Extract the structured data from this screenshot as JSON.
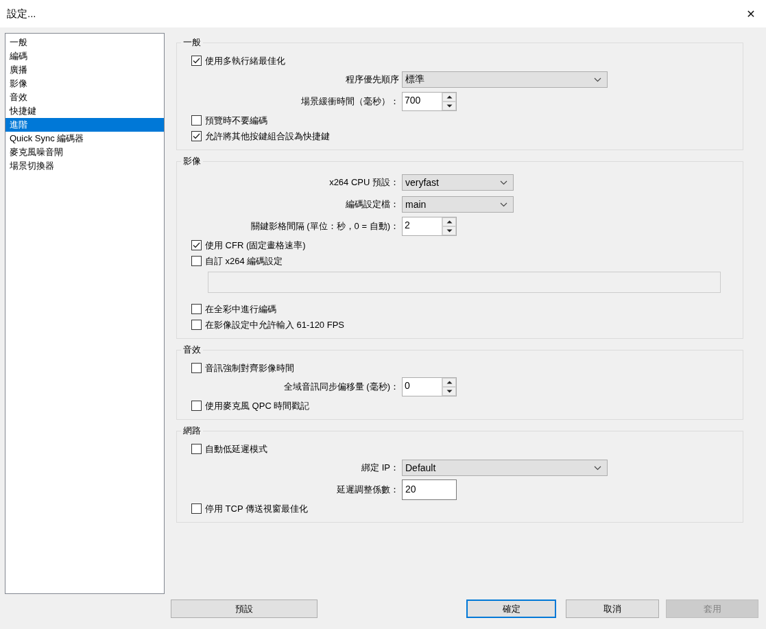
{
  "window": {
    "title": "設定...",
    "close": "✕"
  },
  "sidebar": {
    "items": [
      {
        "label": "一般",
        "selected": false
      },
      {
        "label": "編碼",
        "selected": false
      },
      {
        "label": "廣播",
        "selected": false
      },
      {
        "label": "影像",
        "selected": false
      },
      {
        "label": "音效",
        "selected": false
      },
      {
        "label": "快捷鍵",
        "selected": false
      },
      {
        "label": "進階",
        "selected": true
      },
      {
        "label": "Quick Sync 編碼器",
        "selected": false
      },
      {
        "label": "麥克風噪音閘",
        "selected": false
      },
      {
        "label": "場景切換器",
        "selected": false
      }
    ]
  },
  "sections": [
    {
      "title": "一般",
      "rows": [
        {
          "kind": "checkbox",
          "label": "使用多執行緒最佳化",
          "checked": true
        },
        {
          "kind": "select",
          "label": "程序優先順序",
          "value": "標準",
          "wide": true
        },
        {
          "kind": "spin",
          "label": "場景緩衝時間（毫秒）：",
          "value": "700"
        },
        {
          "kind": "checkbox",
          "label": "預覽時不要編碼",
          "checked": false
        },
        {
          "kind": "checkbox",
          "label": "允許將其他按鍵組合設為快捷鍵",
          "checked": true
        }
      ]
    },
    {
      "title": "影像",
      "rows": [
        {
          "kind": "select",
          "label": "x264 CPU 預設：",
          "value": "veryfast",
          "wide": false
        },
        {
          "kind": "select",
          "label": "編碼設定檔：",
          "value": "main",
          "wide": false
        },
        {
          "kind": "spin",
          "label": "關鍵影格間隔 (單位：秒，0 = 自動)：",
          "value": "2"
        },
        {
          "kind": "checkbox",
          "label": "使用 CFR (固定畫格速率)",
          "checked": true
        },
        {
          "kind": "checkbox",
          "label": "自訂 x264 編碼設定",
          "checked": false
        },
        {
          "kind": "textbox"
        },
        {
          "kind": "checkbox",
          "label": "在全彩中進行編碼",
          "checked": false
        },
        {
          "kind": "checkbox",
          "label": "在影像設定中允許輸入 61-120 FPS",
          "checked": false
        }
      ]
    },
    {
      "title": "音效",
      "rows": [
        {
          "kind": "checkbox",
          "label": "音訊強制對齊影像時間",
          "checked": false
        },
        {
          "kind": "spin",
          "label": "全域音訊同步偏移量 (毫秒)：",
          "value": "0"
        },
        {
          "kind": "checkbox",
          "label": "使用麥克風 QPC 時間戳記",
          "checked": false
        }
      ]
    },
    {
      "title": "網路",
      "rows": [
        {
          "kind": "checkbox",
          "label": "自動低延遲模式",
          "checked": false
        },
        {
          "kind": "select",
          "label": "綁定 IP：",
          "value": "Default",
          "wide": true
        },
        {
          "kind": "input",
          "label": "延遲調整係數：",
          "value": "20"
        },
        {
          "kind": "checkbox",
          "label": "停用 TCP 傳送視窗最佳化",
          "checked": false
        }
      ]
    }
  ],
  "buttons": [
    {
      "label": "預設",
      "default": false,
      "disabled": false
    },
    {
      "label": "確定",
      "default": true,
      "disabled": false
    },
    {
      "label": "取消",
      "default": false,
      "disabled": false
    },
    {
      "label": "套用",
      "default": false,
      "disabled": true
    }
  ]
}
